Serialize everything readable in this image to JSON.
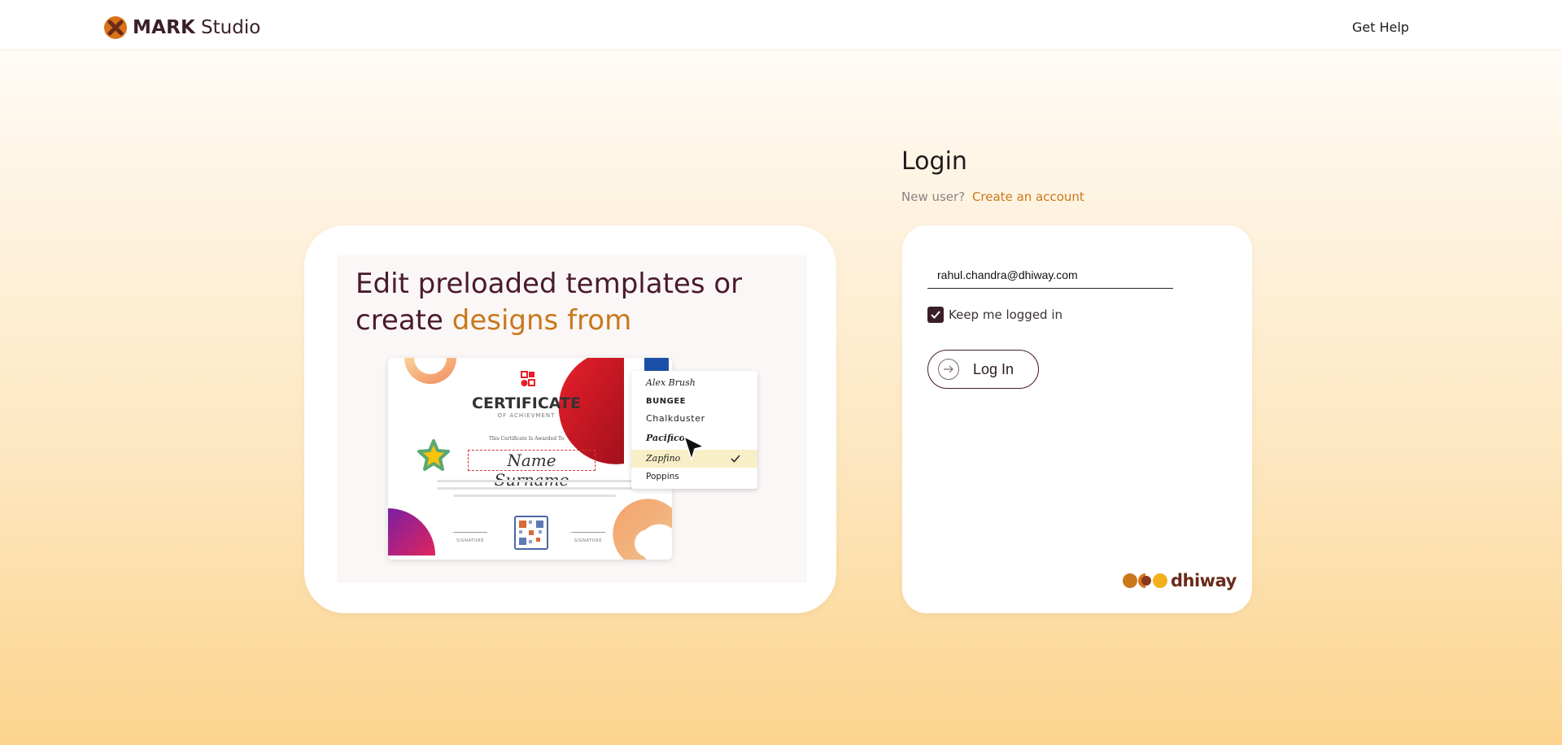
{
  "header": {
    "brand_bold": "MARK",
    "brand_light": "Studio",
    "help_label": "Get Help"
  },
  "promo": {
    "headline_part1": "Edit preloaded templates or create",
    "headline_accent": "designs from",
    "certificate": {
      "title": "CERTIFICATE",
      "subtitle": "OF ACHIEVMENT",
      "awarded_text": "This Certificate Is Awarded To",
      "name_placeholder": "Name Surname",
      "signature_left": "SIGNATURE",
      "signature_right": "SIGNATURE"
    },
    "font_menu": {
      "items": [
        "Alex Brush",
        "BUNGEE",
        "Chalkduster",
        "Pacifico",
        "Zapfino",
        "Poppins"
      ],
      "selected": "Zapfino"
    }
  },
  "login": {
    "title": "Login",
    "new_user_text": "New user?",
    "create_account_label": "Create an account",
    "email_value": "rahul.chandra@dhiway.com",
    "remember_label": "Keep me logged in",
    "remember_checked": true,
    "login_button_label": "Log In",
    "footer_brand": "dhiway"
  },
  "colors": {
    "brand_dark": "#3a1f2a",
    "accent_orange": "#c9781c",
    "background_top": "#ffffff",
    "background_bottom": "#fcd48e"
  },
  "icons": {
    "brand_logo": "mark-studio-logo-icon",
    "login_arrow": "arrow-right-circle-icon",
    "checkbox": "check-icon",
    "dhiway_logo": "dhiway-logo-icon"
  }
}
